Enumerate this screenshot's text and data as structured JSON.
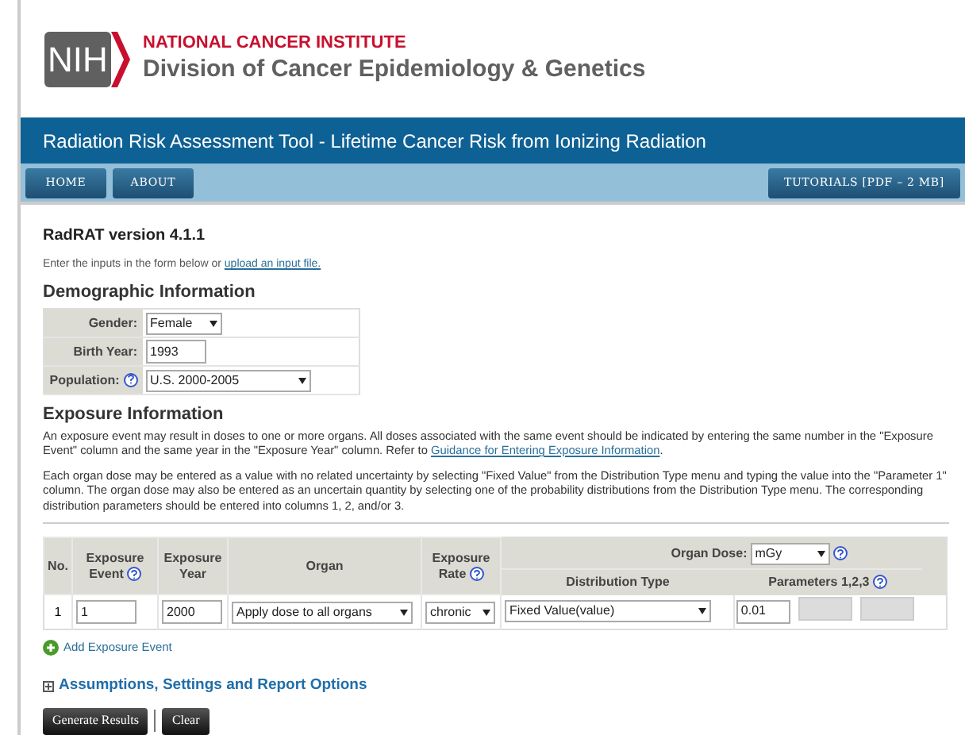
{
  "header": {
    "logo": "NIH",
    "institute": "NATIONAL CANCER INSTITUTE",
    "division": "Division of Cancer Epidemiology & Genetics"
  },
  "title_bar": "Radiation Risk Assessment Tool - Lifetime Cancer Risk from Ionizing Radiation",
  "nav": {
    "left": [
      "HOME",
      "ABOUT"
    ],
    "right": [
      "TUTORIALS [PDF – 2 MB]"
    ]
  },
  "version": "RadRAT version 4.1.1",
  "intro": {
    "text": "Enter the inputs in the form below or ",
    "link": "upload an input file."
  },
  "demographic": {
    "heading": "Demographic Information",
    "fields": [
      {
        "label": "Gender:",
        "kind": "select",
        "value": "Female",
        "help": false
      },
      {
        "label": "Birth Year:",
        "kind": "input",
        "value": "1993",
        "help": false
      },
      {
        "label": "Population:",
        "kind": "select",
        "value": "U.S. 2000-2005",
        "help": true
      }
    ]
  },
  "exposure": {
    "heading": "Exposure Information",
    "paragraph_1": "An exposure event may result in doses to one or more organs. All doses associated with the same event should be indicated by entering the same number in the \"Exposure Event\" column and the same year in the \"Exposure Year\" column. Refer to ",
    "paragraph_1_link": "Guidance for Entering Exposure Information",
    "paragraph_1_end": ".",
    "paragraph_2": "Each organ dose may be entered as a value with no related uncertainty by selecting \"Fixed Value\" from the Distribution Type menu and typing the value into the \"Parameter 1\" column. The organ dose may also be entered as an uncertain quantity by selecting one of the probability distributions from the Distribution Type menu. The corresponding distribution parameters should be entered into columns 1, 2, and/or 3."
  },
  "table": {
    "columns": {
      "no": "No.",
      "event_1": "Exposure",
      "event_2": "Event",
      "year_1": "Exposure",
      "year_2": "Year",
      "organ": "Organ",
      "rate_1": "Exposure",
      "rate_2": "Rate",
      "organ_dose": "Organ Dose:",
      "unit": "mGy",
      "distribution": "Distribution Type",
      "parameters": "Parameters 1,2,3"
    },
    "rows": [
      {
        "no": "1",
        "event": "1",
        "year": "2000",
        "organ": "Apply dose to all organs",
        "rate": "chronic",
        "distribution": "Fixed Value(value)",
        "parameters": [
          {
            "value": "0.01",
            "disabled": false
          },
          {
            "disabled": true
          },
          {
            "disabled": true
          }
        ]
      }
    ]
  },
  "add_link": "Add Exposure Event",
  "options": {
    "label": "Assumptions, Settings and Report Options",
    "expanded": false
  },
  "buttons": [
    "Generate Results",
    "Clear"
  ]
}
